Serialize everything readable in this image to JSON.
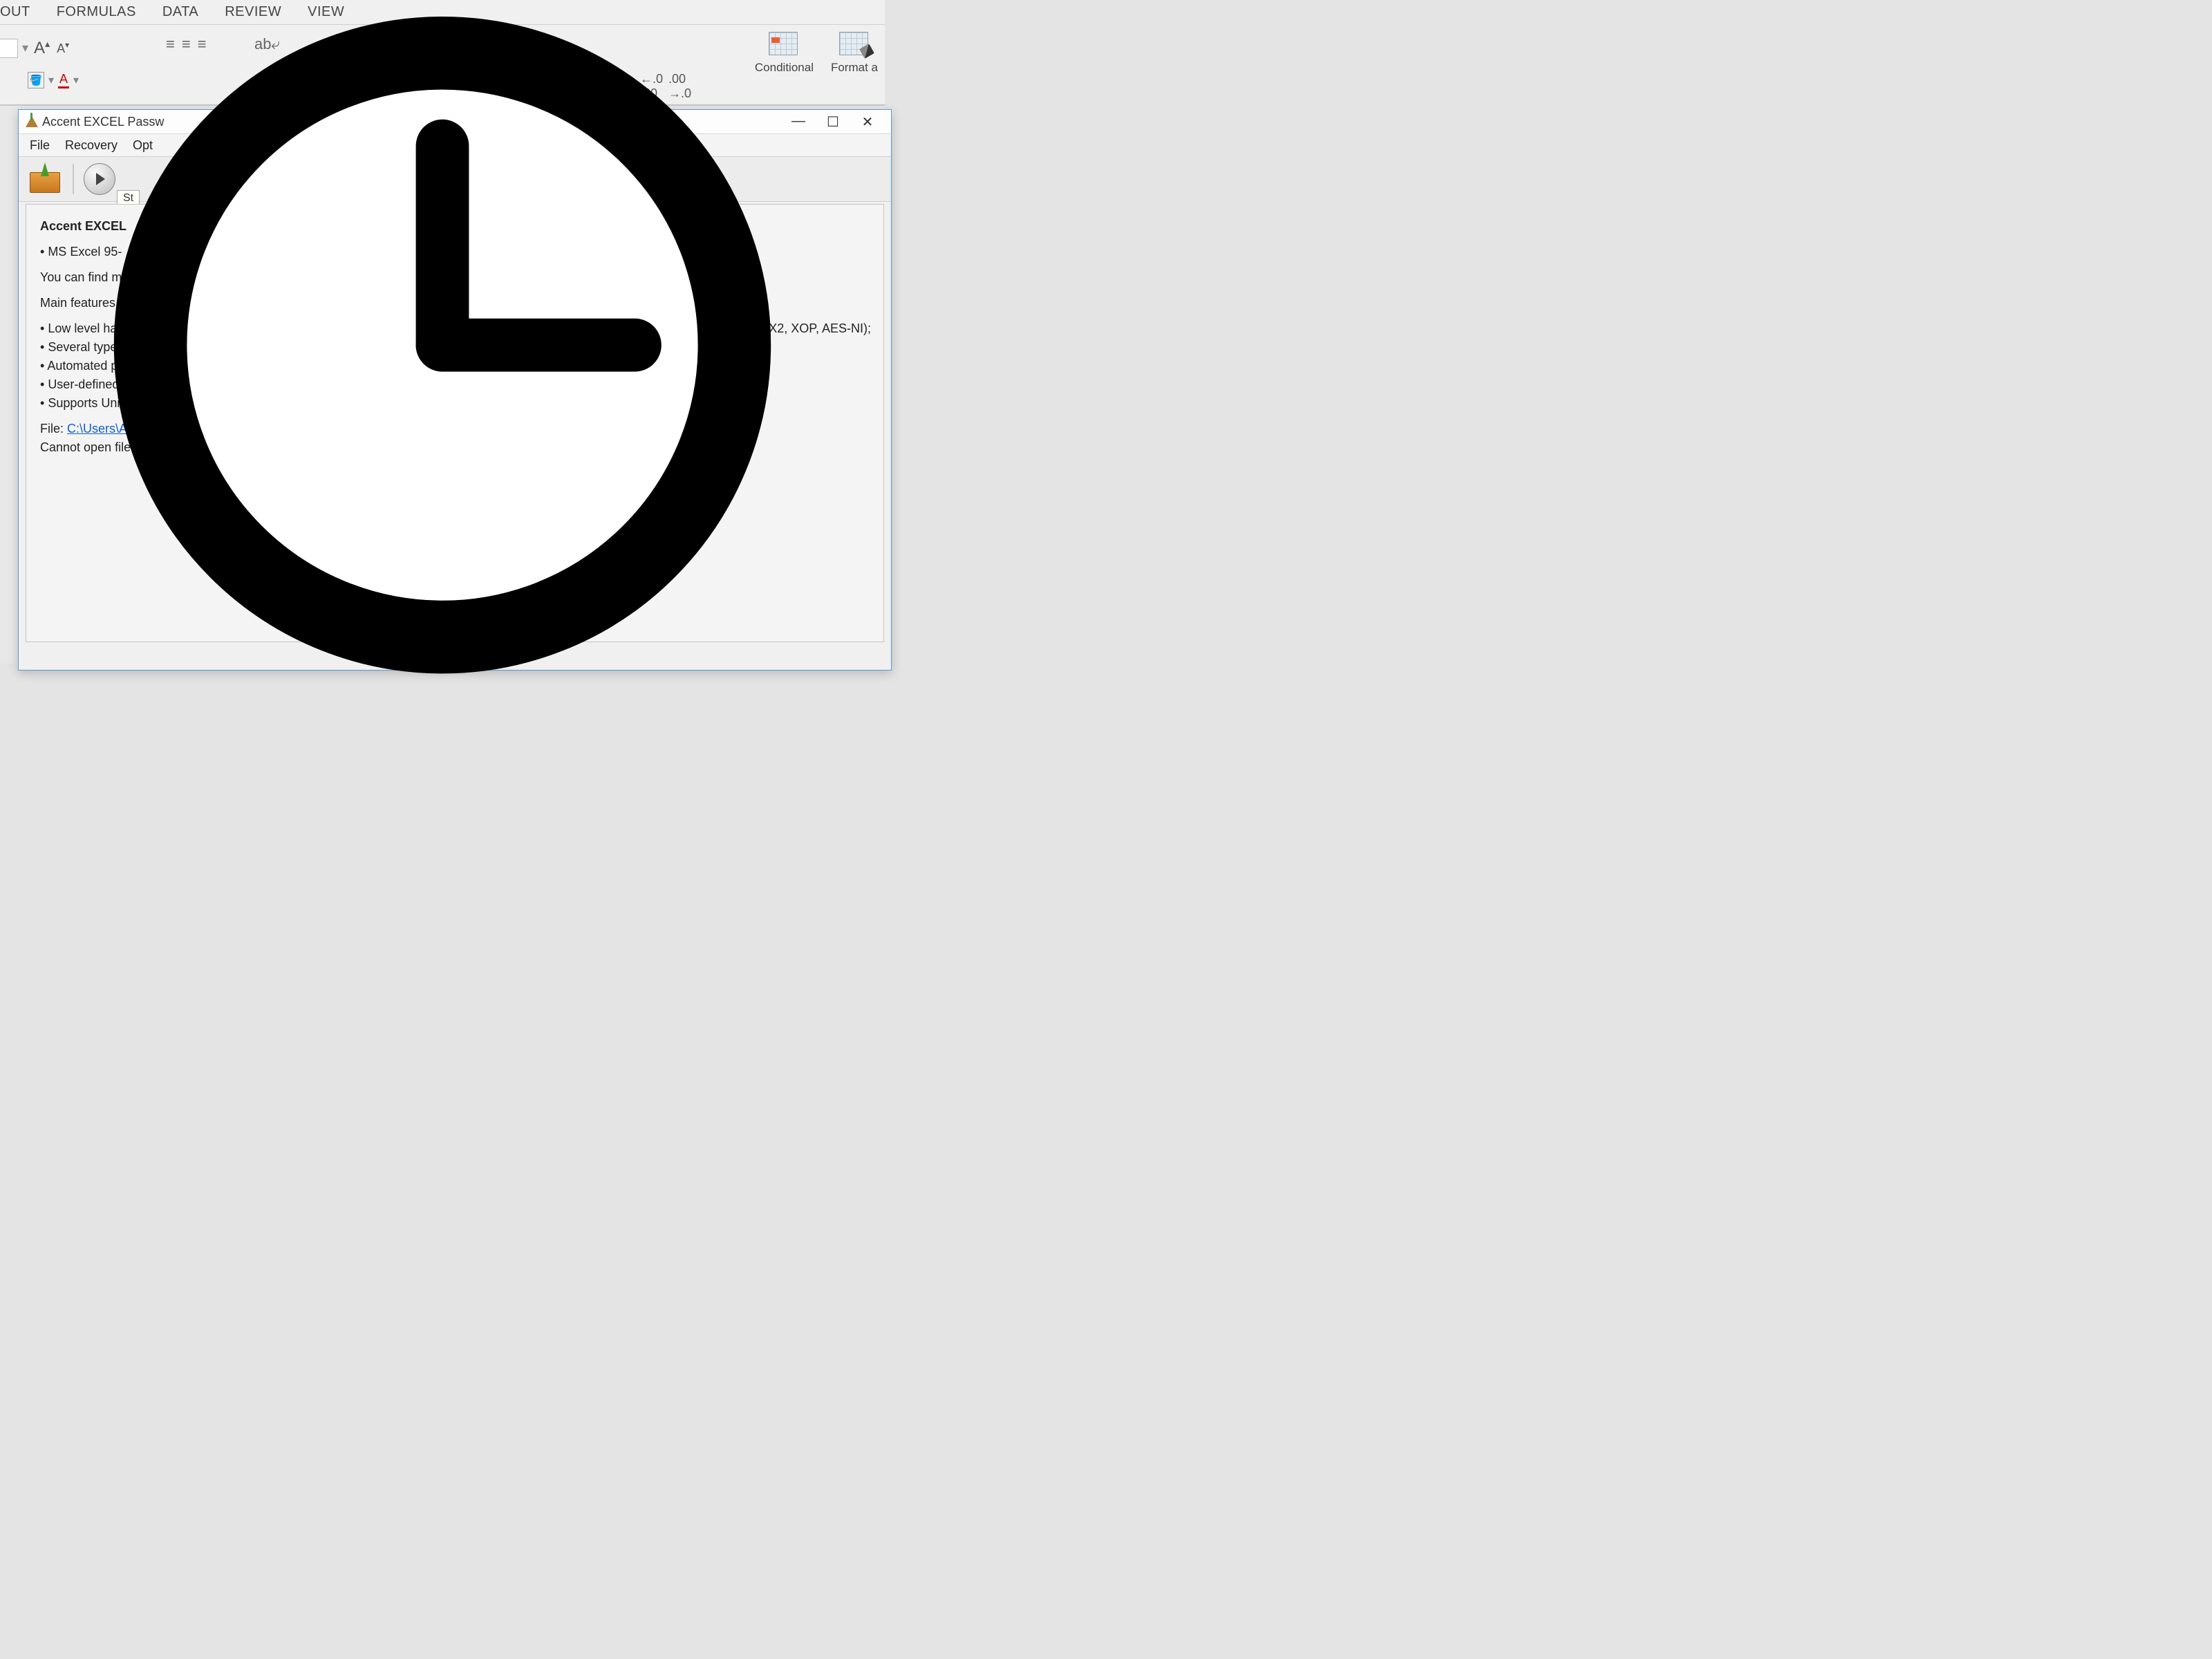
{
  "ribbon": {
    "tabs": [
      "OUT",
      "FORMULAS",
      "DATA",
      "REVIEW",
      "VIEW"
    ],
    "decrease_decimal": "←.0",
    "increase_decimal": ".00→",
    "styles": {
      "conditional": "Conditional",
      "format_as": "Format a"
    }
  },
  "app": {
    "title": "Accent EXCEL Passw",
    "menu": [
      "File",
      "Recovery",
      "Opt"
    ],
    "tooltip": "St",
    "heading": "Accent EXCEL",
    "line_excel_versions": "MS Excel 95-",
    "line_find": "You can find m",
    "line_main_features": "Main features a",
    "bullets": [
      "Low level hand",
      "Several types of",
      "Automated passw",
      "User-defined sets",
      "Supports Unicode an"
    ],
    "cpu_tail": "X2, XOP, AES-NI);",
    "file_label": "File: ",
    "file_path": "C:\\Users\\ADMIN\\Deskt",
    "error_line": "Cannot open file."
  }
}
